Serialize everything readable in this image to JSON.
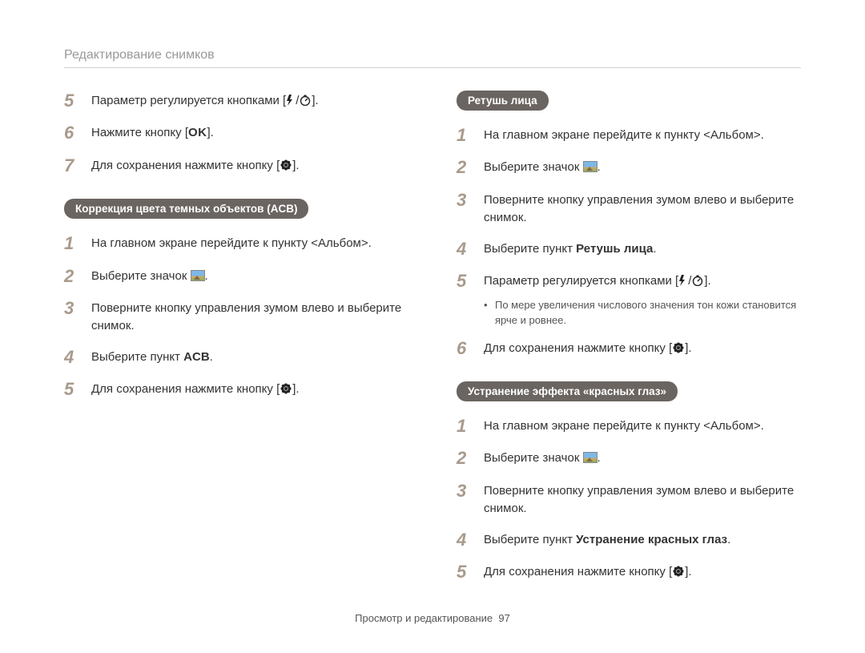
{
  "header": "Редактирование снимков",
  "left": {
    "steps_top": [
      {
        "n": "5",
        "text_a": "Параметр регулируется кнопками [",
        "icon": "flash-timer",
        "text_b": "]."
      },
      {
        "n": "6",
        "text_a": "Нажмите кнопку [",
        "icon": "ok",
        "text_b": "]."
      },
      {
        "n": "7",
        "text_a": "Для сохранения нажмите кнопку [",
        "icon": "flower",
        "text_b": "]."
      }
    ],
    "pill": "Коррекция цвета темных объектов (ACB)",
    "steps_acb": [
      {
        "n": "1",
        "text": "На главном экране перейдите к пункту <Альбом>."
      },
      {
        "n": "2",
        "text_a": "Выберите значок ",
        "icon": "thumb",
        "text_b": "."
      },
      {
        "n": "3",
        "text": "Поверните кнопку управления зумом влево и выберите снимок."
      },
      {
        "n": "4",
        "text_a": "Выберите пункт ",
        "bold": "ACB",
        "text_b": "."
      },
      {
        "n": "5",
        "text_a": "Для сохранения нажмите кнопку [",
        "icon": "flower",
        "text_b": "]."
      }
    ]
  },
  "right": {
    "pill_face": "Ретушь лица",
    "steps_face": [
      {
        "n": "1",
        "text": "На главном экране перейдите к пункту <Альбом>."
      },
      {
        "n": "2",
        "text_a": "Выберите значок ",
        "icon": "thumb",
        "text_b": "."
      },
      {
        "n": "3",
        "text": "Поверните кнопку управления зумом влево и выберите снимок."
      },
      {
        "n": "4",
        "text_a": "Выберите пункт ",
        "bold": "Ретушь лица",
        "text_b": "."
      },
      {
        "n": "5",
        "text_a": "Параметр регулируется кнопками [",
        "icon": "flash-timer",
        "text_b": "]."
      }
    ],
    "note": "По мере увеличения числового значения тон кожи становится ярче и ровнее.",
    "steps_face2": [
      {
        "n": "6",
        "text_a": "Для сохранения нажмите кнопку [",
        "icon": "flower",
        "text_b": "]."
      }
    ],
    "pill_redeye": "Устранение эффекта «красных глаз»",
    "steps_redeye": [
      {
        "n": "1",
        "text": "На главном экране перейдите к пункту <Альбом>."
      },
      {
        "n": "2",
        "text_a": "Выберите значок ",
        "icon": "thumb",
        "text_b": "."
      },
      {
        "n": "3",
        "text": "Поверните кнопку управления зумом влево и выберите снимок."
      },
      {
        "n": "4",
        "text_a": "Выберите пункт ",
        "bold": "Устранение красных глаз",
        "text_b": "."
      },
      {
        "n": "5",
        "text_a": "Для сохранения нажмите кнопку [",
        "icon": "flower",
        "text_b": "]."
      }
    ]
  },
  "footer": {
    "text": "Просмотр и редактирование",
    "page": "97"
  }
}
